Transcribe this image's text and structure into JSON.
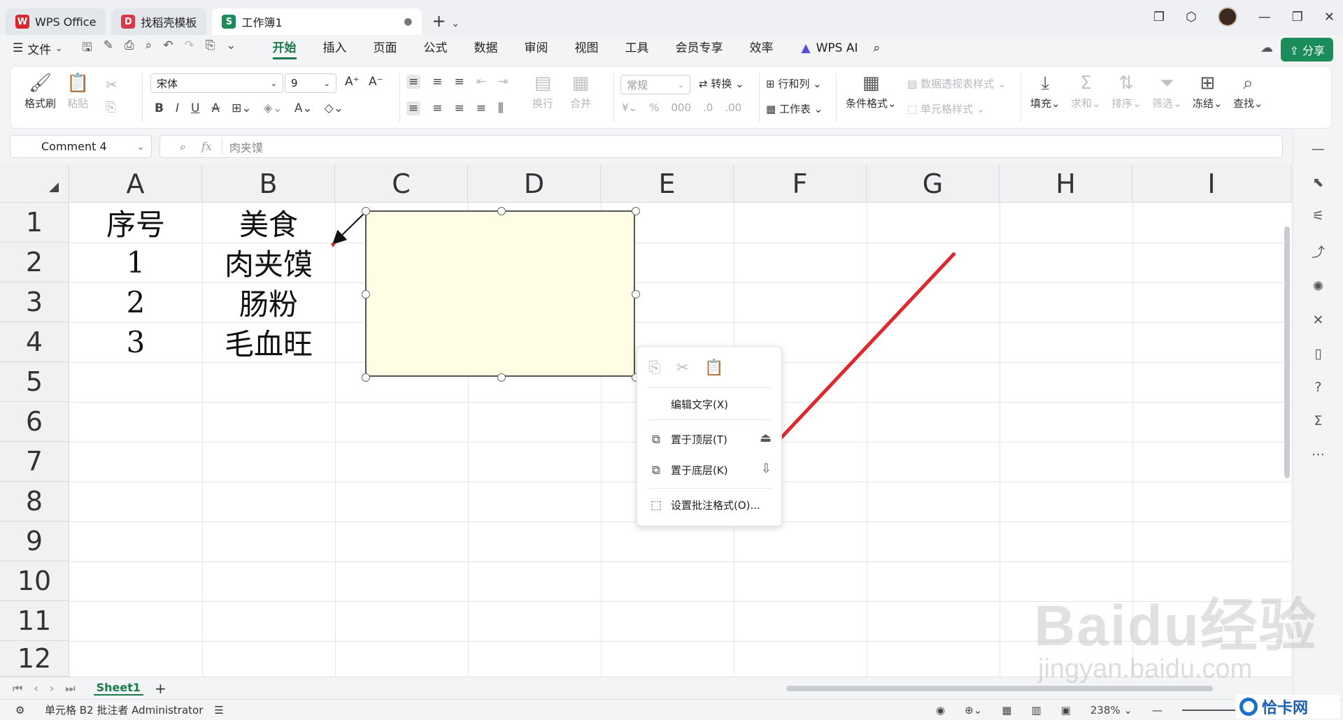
{
  "tabs": [
    {
      "label": "WPS Office",
      "logo": "W",
      "color": "#d9262c"
    },
    {
      "label": "找稻壳模板",
      "logo": "D",
      "color": "#d83a4a"
    },
    {
      "label": "工作簿1",
      "logo": "S",
      "color": "#1a8d5a",
      "active": true
    }
  ],
  "menubar": {
    "file": "文件",
    "items": [
      "开始",
      "插入",
      "页面",
      "公式",
      "数据",
      "审阅",
      "视图",
      "工具",
      "会员专享",
      "效率"
    ],
    "active": "开始",
    "wps_ai": "WPS AI",
    "share": "分享"
  },
  "ribbon": {
    "format_painter": "格式刷",
    "paste": "粘贴",
    "font_name": "宋体",
    "font_size": "9",
    "number_format": "常规",
    "convert": "转换",
    "rows_cols": "行和列",
    "worksheet": "工作表",
    "conditional_format": "条件格式",
    "pivot_style": "数据透视表样式",
    "cell_style": "单元格样式",
    "wrap": "换行",
    "merge": "合并",
    "fill": "填充",
    "sum": "求和",
    "sort": "排序",
    "filter": "筛选",
    "freeze": "冻结",
    "find": "查找"
  },
  "formula_bar": {
    "name_box": "Comment 4",
    "fx": "fx",
    "value": "肉夹馍"
  },
  "grid": {
    "columns": [
      "A",
      "B",
      "C",
      "D",
      "E",
      "F",
      "G",
      "H",
      "I"
    ],
    "rows": [
      "1",
      "2",
      "3",
      "4",
      "5",
      "6",
      "7",
      "8",
      "9",
      "10",
      "11",
      "12"
    ],
    "cells": {
      "A1": "序号",
      "B1": "美食",
      "A2": "1",
      "B2": "肉夹馍",
      "A3": "2",
      "B3": "肠粉",
      "A4": "3",
      "B4": "毛血旺"
    }
  },
  "context_menu": {
    "edit_text": "编辑文字(X)",
    "bring_front": "置于顶层(T)",
    "send_back": "置于底层(K)",
    "format_comment": "设置批注格式(O)..."
  },
  "sheet_tabs": [
    "Sheet1"
  ],
  "status": {
    "cell_info": "单元格 B2 批注者 Administrator",
    "zoom": "238%"
  },
  "watermark": {
    "main": "Baidu经验",
    "url": "jingyan.baidu.com",
    "brand": "恰卡网"
  },
  "colors": {
    "accent": "#1a7a4c",
    "comment_fill": "#fffde3",
    "arrow": "#e3262b"
  }
}
